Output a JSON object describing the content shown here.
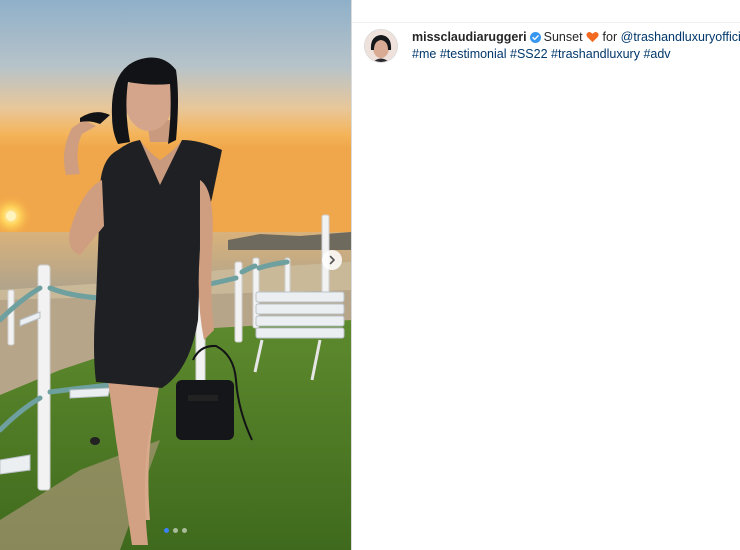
{
  "post": {
    "username": "missclaudiaruggeri",
    "caption_word": "Sunset",
    "caption_for": "for",
    "mention": "@trashandluxuryofficial",
    "hashtags": [
      "#me",
      "#testimonial",
      "#SS22",
      "#trashandluxury",
      "#adv"
    ]
  },
  "icons": {
    "verified": "verified-badge-icon",
    "heart": "orange-heart-icon",
    "next": "chevron-right-icon"
  },
  "colors": {
    "link": "#00376b",
    "verified": "#3897f0",
    "heart": "#f26a22",
    "active_dot": "#3b82f6"
  },
  "carousel": {
    "total": 3,
    "current": 1
  }
}
